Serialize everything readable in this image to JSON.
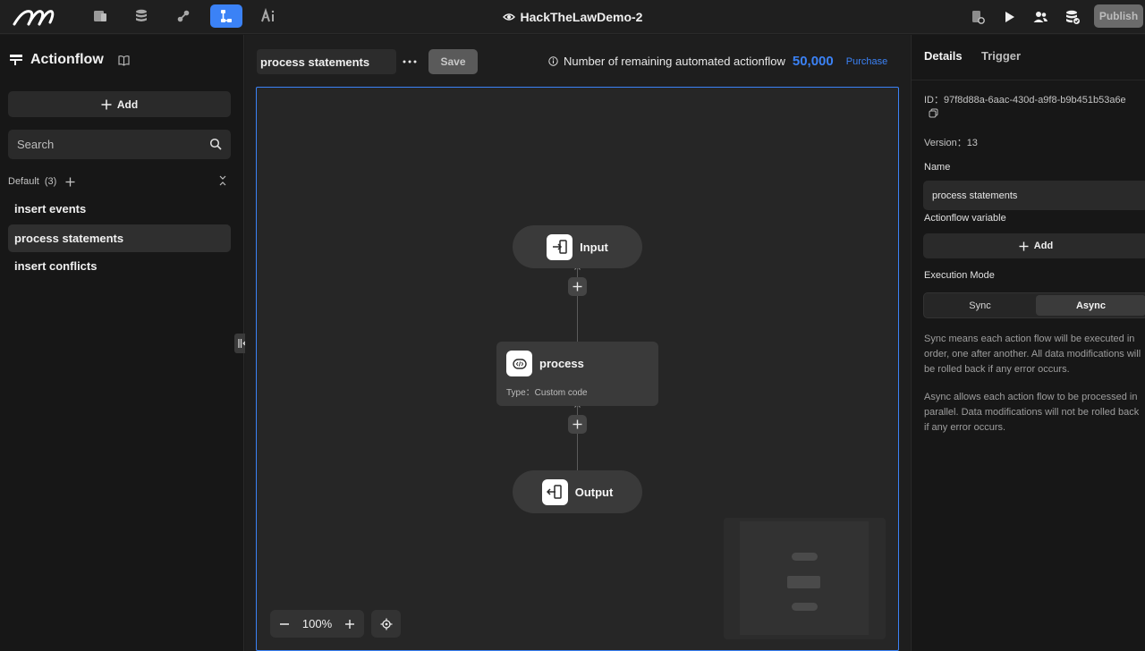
{
  "app": {
    "project_name": "HackTheLawDemo-2",
    "publish_label": "Publish"
  },
  "top_nav": [
    {
      "name": "pages-icon",
      "active": false
    },
    {
      "name": "database-icon",
      "active": false
    },
    {
      "name": "api-icon",
      "active": false
    },
    {
      "name": "actionflow-icon",
      "active": true
    },
    {
      "name": "ai-icon",
      "active": false
    }
  ],
  "sidebar": {
    "title": "Actionflow",
    "add_label": "Add",
    "search_placeholder": "Search",
    "group": {
      "name": "Default",
      "count": "(3)"
    },
    "items": [
      {
        "label": "insert events",
        "selected": false
      },
      {
        "label": "process statements",
        "selected": true
      },
      {
        "label": "insert conflicts",
        "selected": false
      }
    ]
  },
  "toolbar": {
    "flow_name": "process statements",
    "save_label": "Save",
    "remaining_text": "Number of remaining automated actionflow",
    "remaining_count": "50,000",
    "purchase_label": "Purchase"
  },
  "canvas": {
    "input_node": "Input",
    "process_node": {
      "title": "process",
      "type": "Type：Custom code"
    },
    "output_node": "Output",
    "zoom": "100%"
  },
  "details": {
    "tabs": [
      "Details",
      "Trigger"
    ],
    "id_text": "ID：97f8d88a-6aac-430d-a9f8-b9b451b53a6e",
    "version_text": "Version：13",
    "name_label": "Name",
    "name_value": "process statements",
    "variable_label": "Actionflow variable",
    "variable_add": "Add",
    "mode_label": "Execution Mode",
    "modes": [
      "Sync",
      "Async"
    ],
    "selected_mode": "Async",
    "sync_desc": "Sync means each action flow will be executed in order, one after another. All data modifications will be rolled back if any error occurs.",
    "async_desc": "Async allows each action flow to be processed in parallel. Data modifications will not be rolled back if any error occurs."
  },
  "colors": {
    "accent": "#3b82f6",
    "background": "#1b1b1b"
  }
}
